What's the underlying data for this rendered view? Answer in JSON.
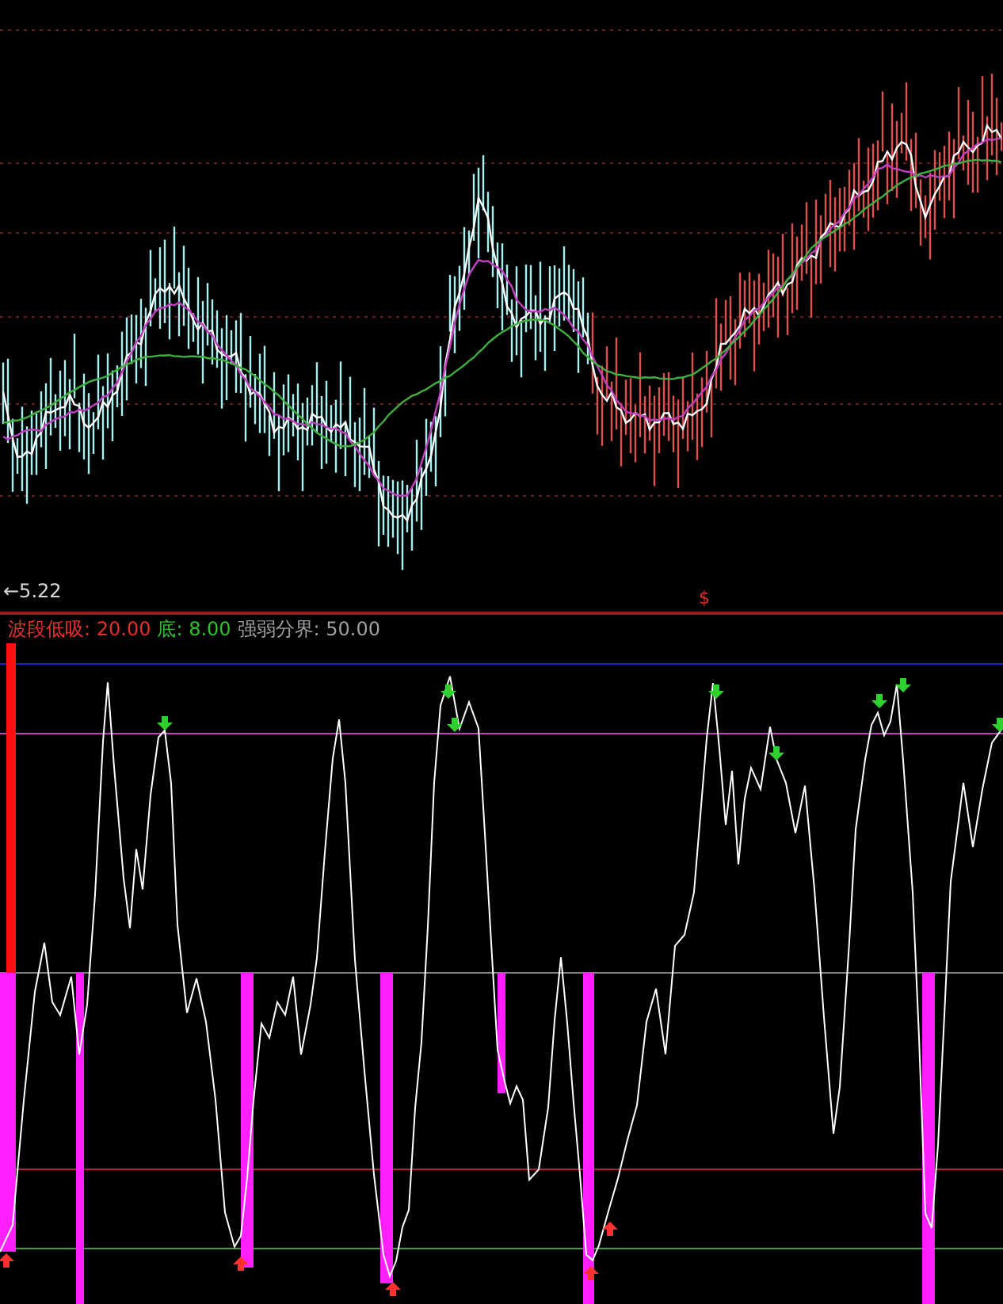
{
  "price_panel": {
    "low_label": "←5.22",
    "signal_mark": "$"
  },
  "indicator_panel": {
    "legend": [
      {
        "label": "波段低吸:",
        "value": "20.00",
        "color": "#e0302c"
      },
      {
        "label": "底:",
        "value": "8.00",
        "color": "#2fc02f"
      },
      {
        "label": "强弱分界:",
        "value": "50.00",
        "color": "#a0a0a0"
      }
    ]
  }
}
